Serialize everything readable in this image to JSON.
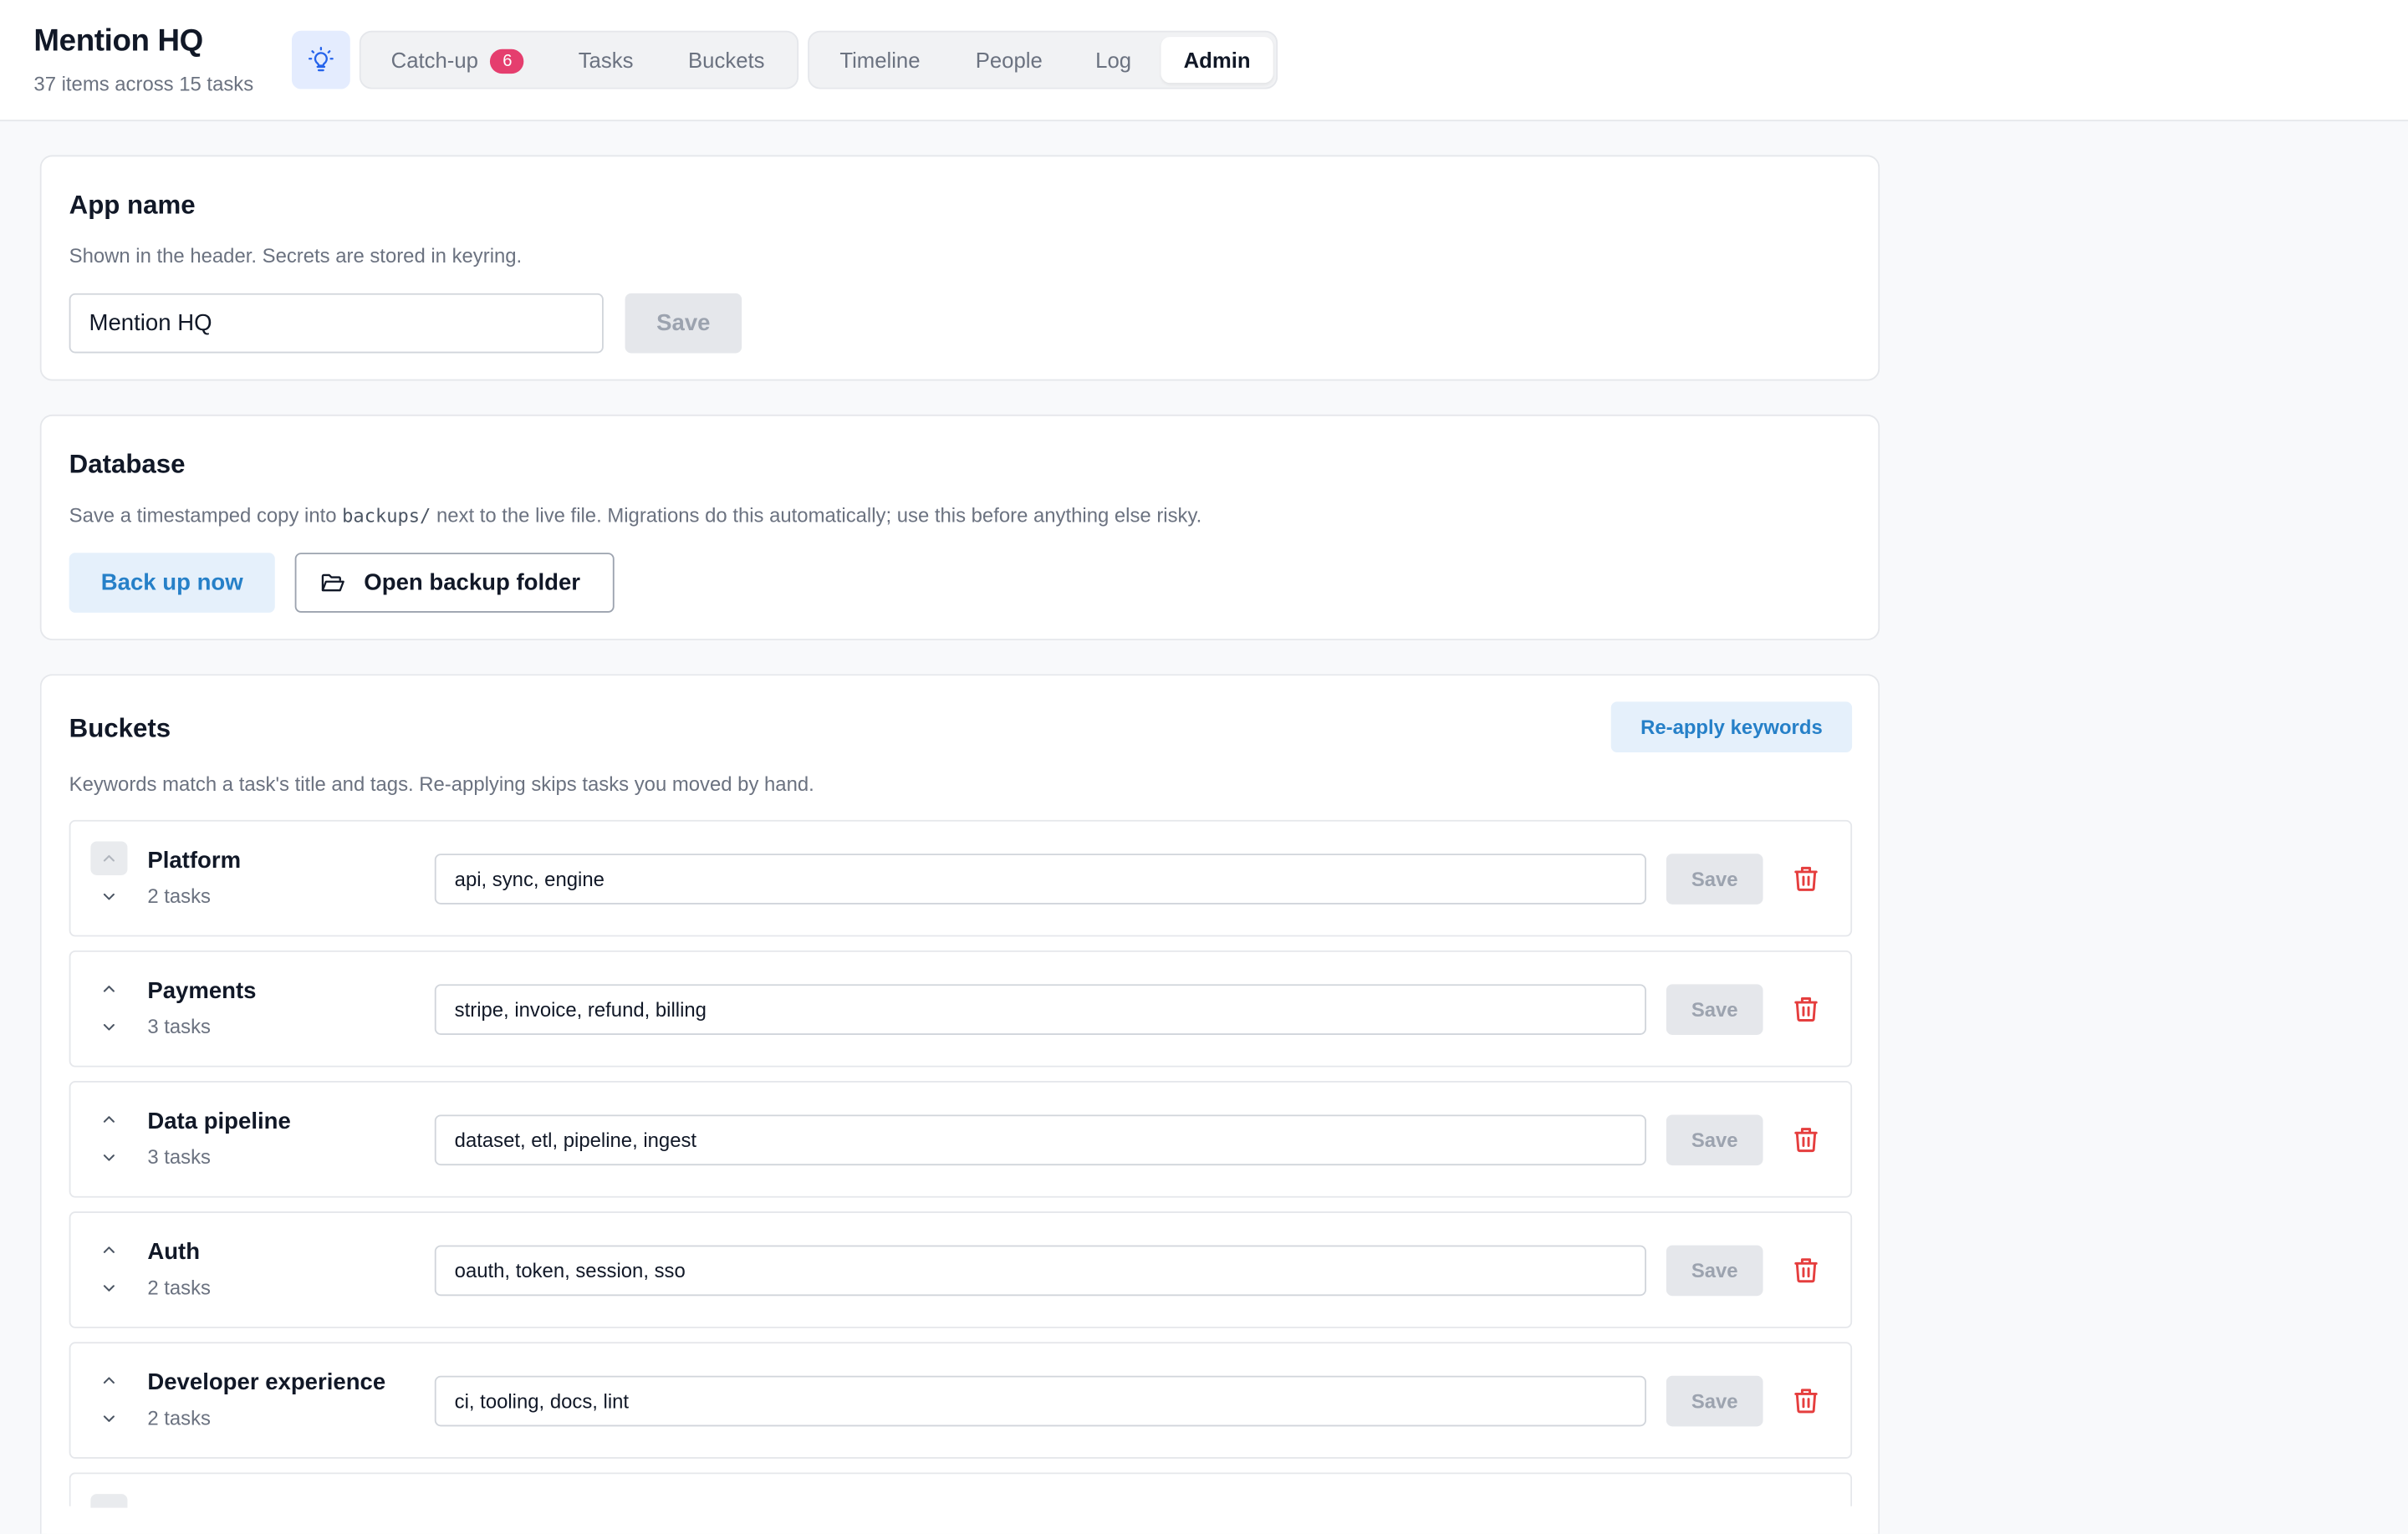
{
  "app": {
    "title": "Mention HQ",
    "subtitle": "37 items across 15 tasks",
    "accent": "#2680c8",
    "badge_color": "#e53e6e"
  },
  "nav": {
    "group1": [
      {
        "label": "Catch-up",
        "badge": "6"
      },
      {
        "label": "Tasks"
      },
      {
        "label": "Buckets"
      }
    ],
    "group2": [
      {
        "label": "Timeline"
      },
      {
        "label": "People"
      },
      {
        "label": "Log"
      },
      {
        "label": "Admin",
        "active": true
      }
    ],
    "idea_icon": "lightbulb-icon"
  },
  "app_name_card": {
    "title": "App name",
    "description": "Shown in the header. Secrets are stored in keyring.",
    "input_value": "Mention HQ",
    "save_label": "Save"
  },
  "database_card": {
    "title": "Database",
    "description_before": "Save a timestamped copy into ",
    "description_code": "backups/",
    "description_after": " next to the live file. Migrations do this automatically; use this before anything else risky.",
    "backup_label": "Back up now",
    "open_folder_label": "Open backup folder",
    "folder_icon": "folder-open-icon"
  },
  "buckets_card": {
    "title": "Buckets",
    "reapply_label": "Re-apply keywords",
    "description": "Keywords match a task's title and tags. Re-applying skips tasks you moved by hand.",
    "save_label": "Save",
    "rows": [
      {
        "name": "Platform",
        "count": "2 tasks",
        "keywords": "api, sync, engine",
        "up_disabled": true
      },
      {
        "name": "Payments",
        "count": "3 tasks",
        "keywords": "stripe, invoice, refund, billing"
      },
      {
        "name": "Data pipeline",
        "count": "3 tasks",
        "keywords": "dataset, etl, pipeline, ingest"
      },
      {
        "name": "Auth",
        "count": "2 tasks",
        "keywords": "oauth, token, session, sso"
      },
      {
        "name": "Developer experience",
        "count": "2 tasks",
        "keywords": "ci, tooling, docs, lint"
      }
    ]
  }
}
